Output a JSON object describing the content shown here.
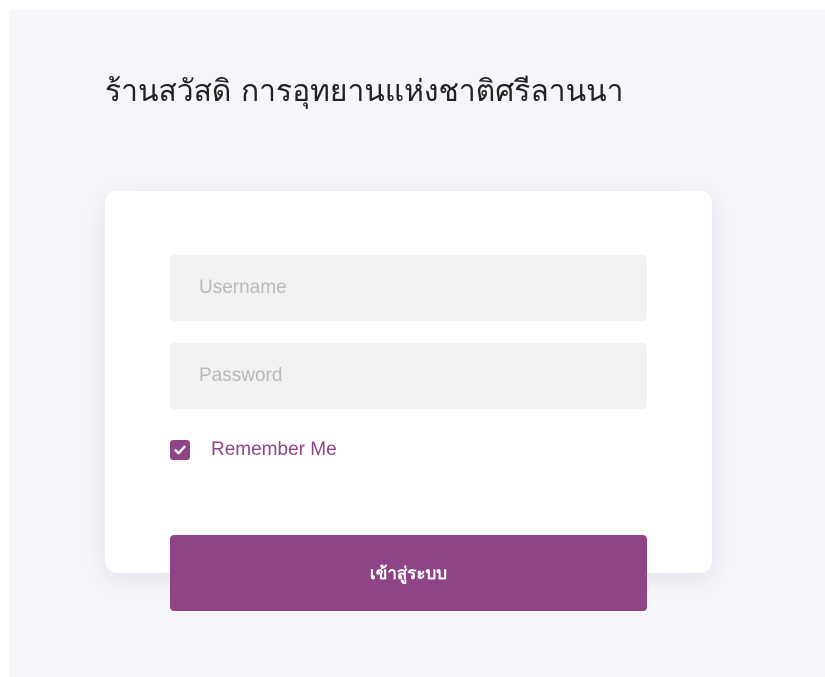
{
  "header": {
    "title": "ร้านสวัสดิ การอุทยานแห่งชาติศรีลานนา"
  },
  "login_form": {
    "username_placeholder": "Username",
    "password_placeholder": "Password",
    "remember_me_label": "Remember Me",
    "remember_me_checked": true,
    "submit_label": "เข้าสู่ระบบ"
  },
  "colors": {
    "accent": "#8e4486",
    "page_background": "#f5f6fa",
    "card_background": "#ffffff",
    "field_background": "#f2f2f2"
  },
  "icons": {
    "checkbox": "check-icon"
  }
}
